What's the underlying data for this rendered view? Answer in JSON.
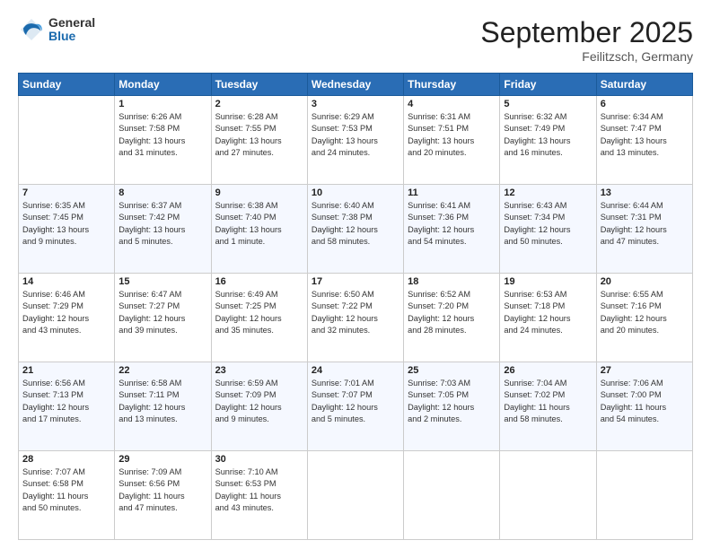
{
  "header": {
    "logo": {
      "general": "General",
      "blue": "Blue"
    },
    "title": "September 2025",
    "subtitle": "Feilitzsch, Germany"
  },
  "weekdays": [
    "Sunday",
    "Monday",
    "Tuesday",
    "Wednesday",
    "Thursday",
    "Friday",
    "Saturday"
  ],
  "weeks": [
    [
      {
        "day": "",
        "info": ""
      },
      {
        "day": "1",
        "info": "Sunrise: 6:26 AM\nSunset: 7:58 PM\nDaylight: 13 hours\nand 31 minutes."
      },
      {
        "day": "2",
        "info": "Sunrise: 6:28 AM\nSunset: 7:55 PM\nDaylight: 13 hours\nand 27 minutes."
      },
      {
        "day": "3",
        "info": "Sunrise: 6:29 AM\nSunset: 7:53 PM\nDaylight: 13 hours\nand 24 minutes."
      },
      {
        "day": "4",
        "info": "Sunrise: 6:31 AM\nSunset: 7:51 PM\nDaylight: 13 hours\nand 20 minutes."
      },
      {
        "day": "5",
        "info": "Sunrise: 6:32 AM\nSunset: 7:49 PM\nDaylight: 13 hours\nand 16 minutes."
      },
      {
        "day": "6",
        "info": "Sunrise: 6:34 AM\nSunset: 7:47 PM\nDaylight: 13 hours\nand 13 minutes."
      }
    ],
    [
      {
        "day": "7",
        "info": "Sunrise: 6:35 AM\nSunset: 7:45 PM\nDaylight: 13 hours\nand 9 minutes."
      },
      {
        "day": "8",
        "info": "Sunrise: 6:37 AM\nSunset: 7:42 PM\nDaylight: 13 hours\nand 5 minutes."
      },
      {
        "day": "9",
        "info": "Sunrise: 6:38 AM\nSunset: 7:40 PM\nDaylight: 13 hours\nand 1 minute."
      },
      {
        "day": "10",
        "info": "Sunrise: 6:40 AM\nSunset: 7:38 PM\nDaylight: 12 hours\nand 58 minutes."
      },
      {
        "day": "11",
        "info": "Sunrise: 6:41 AM\nSunset: 7:36 PM\nDaylight: 12 hours\nand 54 minutes."
      },
      {
        "day": "12",
        "info": "Sunrise: 6:43 AM\nSunset: 7:34 PM\nDaylight: 12 hours\nand 50 minutes."
      },
      {
        "day": "13",
        "info": "Sunrise: 6:44 AM\nSunset: 7:31 PM\nDaylight: 12 hours\nand 47 minutes."
      }
    ],
    [
      {
        "day": "14",
        "info": "Sunrise: 6:46 AM\nSunset: 7:29 PM\nDaylight: 12 hours\nand 43 minutes."
      },
      {
        "day": "15",
        "info": "Sunrise: 6:47 AM\nSunset: 7:27 PM\nDaylight: 12 hours\nand 39 minutes."
      },
      {
        "day": "16",
        "info": "Sunrise: 6:49 AM\nSunset: 7:25 PM\nDaylight: 12 hours\nand 35 minutes."
      },
      {
        "day": "17",
        "info": "Sunrise: 6:50 AM\nSunset: 7:22 PM\nDaylight: 12 hours\nand 32 minutes."
      },
      {
        "day": "18",
        "info": "Sunrise: 6:52 AM\nSunset: 7:20 PM\nDaylight: 12 hours\nand 28 minutes."
      },
      {
        "day": "19",
        "info": "Sunrise: 6:53 AM\nSunset: 7:18 PM\nDaylight: 12 hours\nand 24 minutes."
      },
      {
        "day": "20",
        "info": "Sunrise: 6:55 AM\nSunset: 7:16 PM\nDaylight: 12 hours\nand 20 minutes."
      }
    ],
    [
      {
        "day": "21",
        "info": "Sunrise: 6:56 AM\nSunset: 7:13 PM\nDaylight: 12 hours\nand 17 minutes."
      },
      {
        "day": "22",
        "info": "Sunrise: 6:58 AM\nSunset: 7:11 PM\nDaylight: 12 hours\nand 13 minutes."
      },
      {
        "day": "23",
        "info": "Sunrise: 6:59 AM\nSunset: 7:09 PM\nDaylight: 12 hours\nand 9 minutes."
      },
      {
        "day": "24",
        "info": "Sunrise: 7:01 AM\nSunset: 7:07 PM\nDaylight: 12 hours\nand 5 minutes."
      },
      {
        "day": "25",
        "info": "Sunrise: 7:03 AM\nSunset: 7:05 PM\nDaylight: 12 hours\nand 2 minutes."
      },
      {
        "day": "26",
        "info": "Sunrise: 7:04 AM\nSunset: 7:02 PM\nDaylight: 11 hours\nand 58 minutes."
      },
      {
        "day": "27",
        "info": "Sunrise: 7:06 AM\nSunset: 7:00 PM\nDaylight: 11 hours\nand 54 minutes."
      }
    ],
    [
      {
        "day": "28",
        "info": "Sunrise: 7:07 AM\nSunset: 6:58 PM\nDaylight: 11 hours\nand 50 minutes."
      },
      {
        "day": "29",
        "info": "Sunrise: 7:09 AM\nSunset: 6:56 PM\nDaylight: 11 hours\nand 47 minutes."
      },
      {
        "day": "30",
        "info": "Sunrise: 7:10 AM\nSunset: 6:53 PM\nDaylight: 11 hours\nand 43 minutes."
      },
      {
        "day": "",
        "info": ""
      },
      {
        "day": "",
        "info": ""
      },
      {
        "day": "",
        "info": ""
      },
      {
        "day": "",
        "info": ""
      }
    ]
  ]
}
